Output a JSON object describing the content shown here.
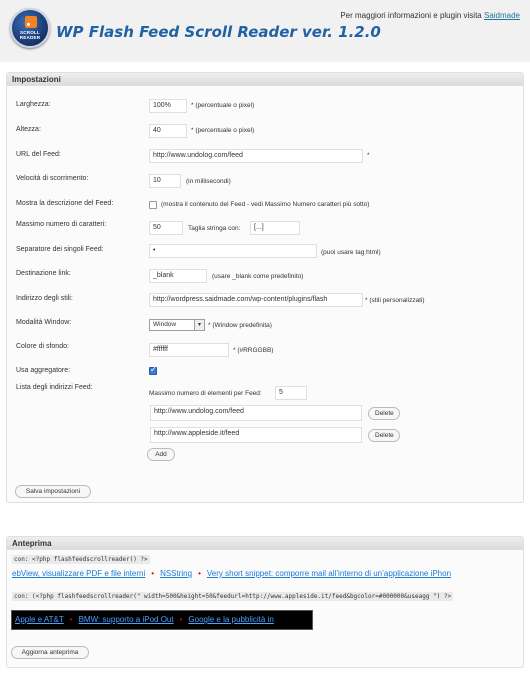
{
  "header": {
    "logo_text": "SCROLL READER",
    "title": "WP Flash Feed Scroll Reader ver. 1.2.0",
    "info_text": "Per maggiori informazioni e plugin visita ",
    "info_link": "Saidmade"
  },
  "settings": {
    "title": "Impostazioni",
    "width": {
      "label": "Larghezza:",
      "value": "100%",
      "hint": "* (percentuale o pixel)"
    },
    "height": {
      "label": "Altezza:",
      "value": "40",
      "hint": "* (percentuale o pixel)"
    },
    "feed_url": {
      "label": "URL del Feed:",
      "value": "http://www.undolog.com/feed",
      "hint": "*"
    },
    "scroll_speed": {
      "label": "Velocità di scorrimento:",
      "value": "10",
      "hint": "(in millisecondi)"
    },
    "show_description": {
      "label": "Mostra la descrizione del Feed:",
      "checked": false,
      "hint": "(mostra il contenuto del Feed - vedi Massimo Numero caratteri più sotto)"
    },
    "max_chars": {
      "label": "Massimo numero di caratteri:",
      "value": "50",
      "truncate_label": "Taglia stringa con:",
      "truncate_value": "[...]"
    },
    "separator": {
      "label": "Separatore dei singoli Feed:",
      "value": "•",
      "hint": "(puoi usare tag html)"
    },
    "link_target": {
      "label": "Destinazione link:",
      "value": "_blank",
      "hint": "(usare _blank come predefinito)"
    },
    "styles_url": {
      "label": "Indirizzo degli stili:",
      "value": "http://wordpress.saidmade.com/wp-content/plugins/flash",
      "hint": "* (stili personalizzati)"
    },
    "window_mode": {
      "label": "Modalità Window:",
      "value": "Window",
      "hint": "* (Window predefinita)"
    },
    "bg_color": {
      "label": "Colore di sfondo:",
      "value": "#ffffff",
      "hint": "* (#RRGGBB)"
    },
    "use_aggregator": {
      "label": "Usa aggregatore:",
      "checked": true
    },
    "feed_list": {
      "label": "Lista degli indirizzi Feed:",
      "max_items_label": "Massimo numero di elementi per Feed:",
      "max_items_value": "5",
      "feeds": [
        "http://www.undolog.com/feed",
        "http://www.appleside.it/feed"
      ],
      "delete_label": "Delete",
      "add_label": "Add"
    },
    "save_label": "Salva impostazioni"
  },
  "preview": {
    "title": "Anteprima",
    "code1": "con: <?php flashfeedscrollreader() ?>",
    "ticker1": {
      "items": [
        "ebView, visualizzare PDF e file interni",
        "NSString",
        "Very short snippet: comporre mail all’interno di un’applicazione iPhon"
      ],
      "separator": "•"
    },
    "code2": "con: (<?php flashfeedscrollreader(\" width=500&height=50&feedurl=http://www.appleside.it/feed&bgcolor=#000000&useagg \") ?>",
    "ticker2": {
      "items": [
        "Apple e AT&T",
        "BMW: supporto a iPod Out",
        "Google e la pubblicità in"
      ],
      "separator": "•"
    },
    "refresh_label": "Aggiorna anteprima"
  },
  "colors": {
    "title_blue": "#2162a4",
    "link_blue": "#1c7ad8",
    "separator_red": "#dd0000"
  }
}
